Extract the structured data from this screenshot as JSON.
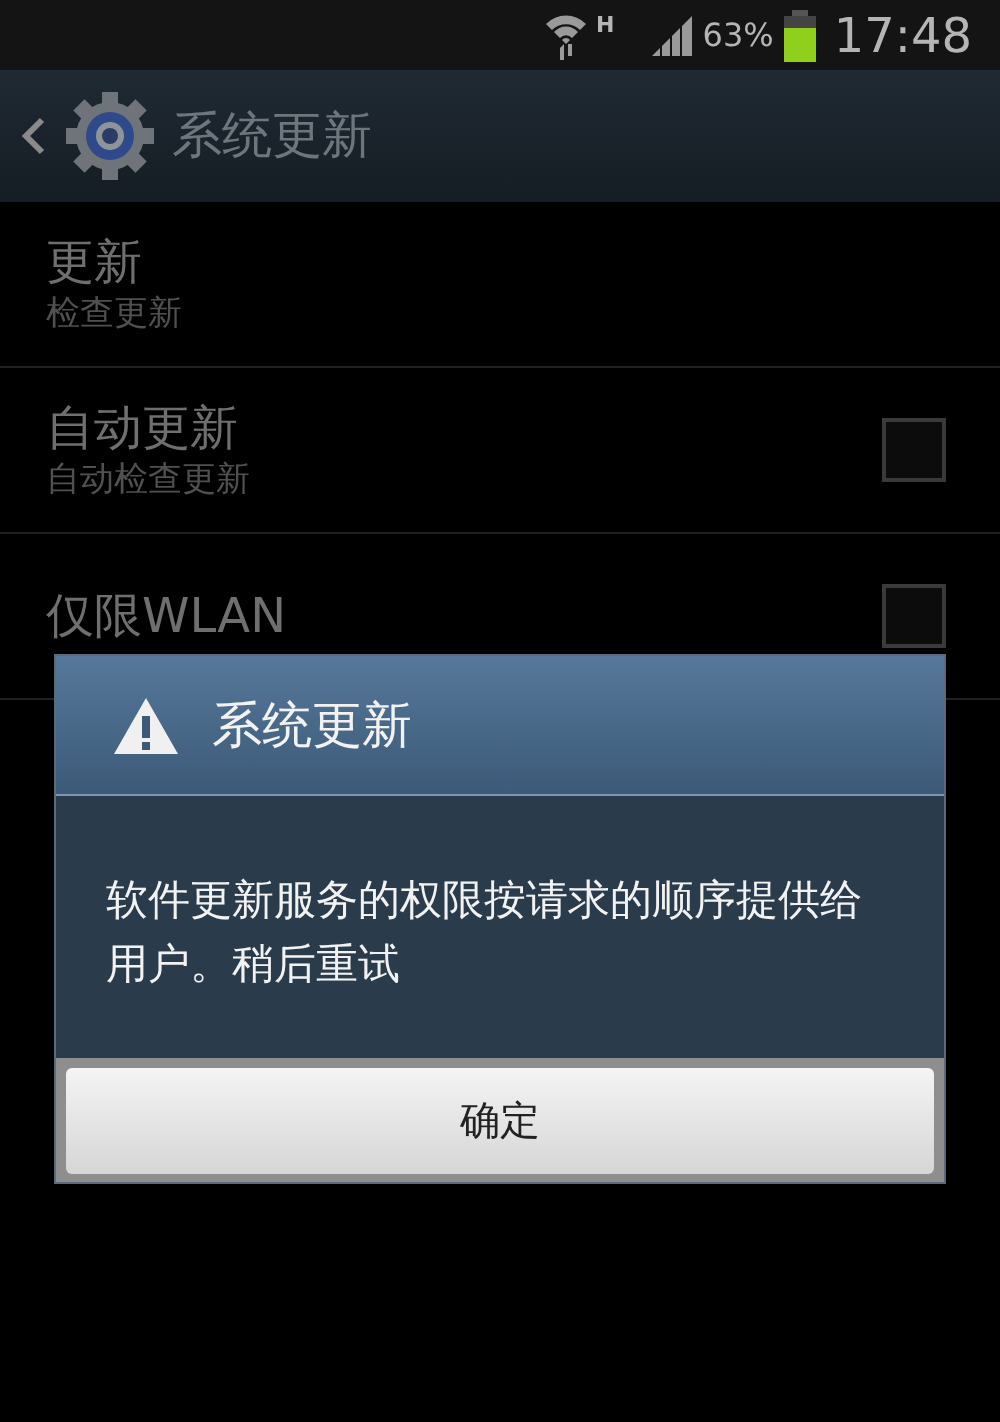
{
  "status_bar": {
    "network": "H",
    "battery": "63%",
    "time": "17:48"
  },
  "action_bar": {
    "title": "系统更新"
  },
  "settings": [
    {
      "kind": "plain",
      "title": "更新",
      "subtitle": "检查更新"
    },
    {
      "kind": "checkbox",
      "title": "自动更新",
      "subtitle": "自动检查更新",
      "checked": false
    },
    {
      "kind": "checkbox",
      "title": "仅限WLAN",
      "checked": false
    }
  ],
  "dialog": {
    "title": "系统更新",
    "message": "软件更新服务的权限按请求的顺序提供给用户。稍后重试",
    "buttons": [
      "确定"
    ]
  }
}
